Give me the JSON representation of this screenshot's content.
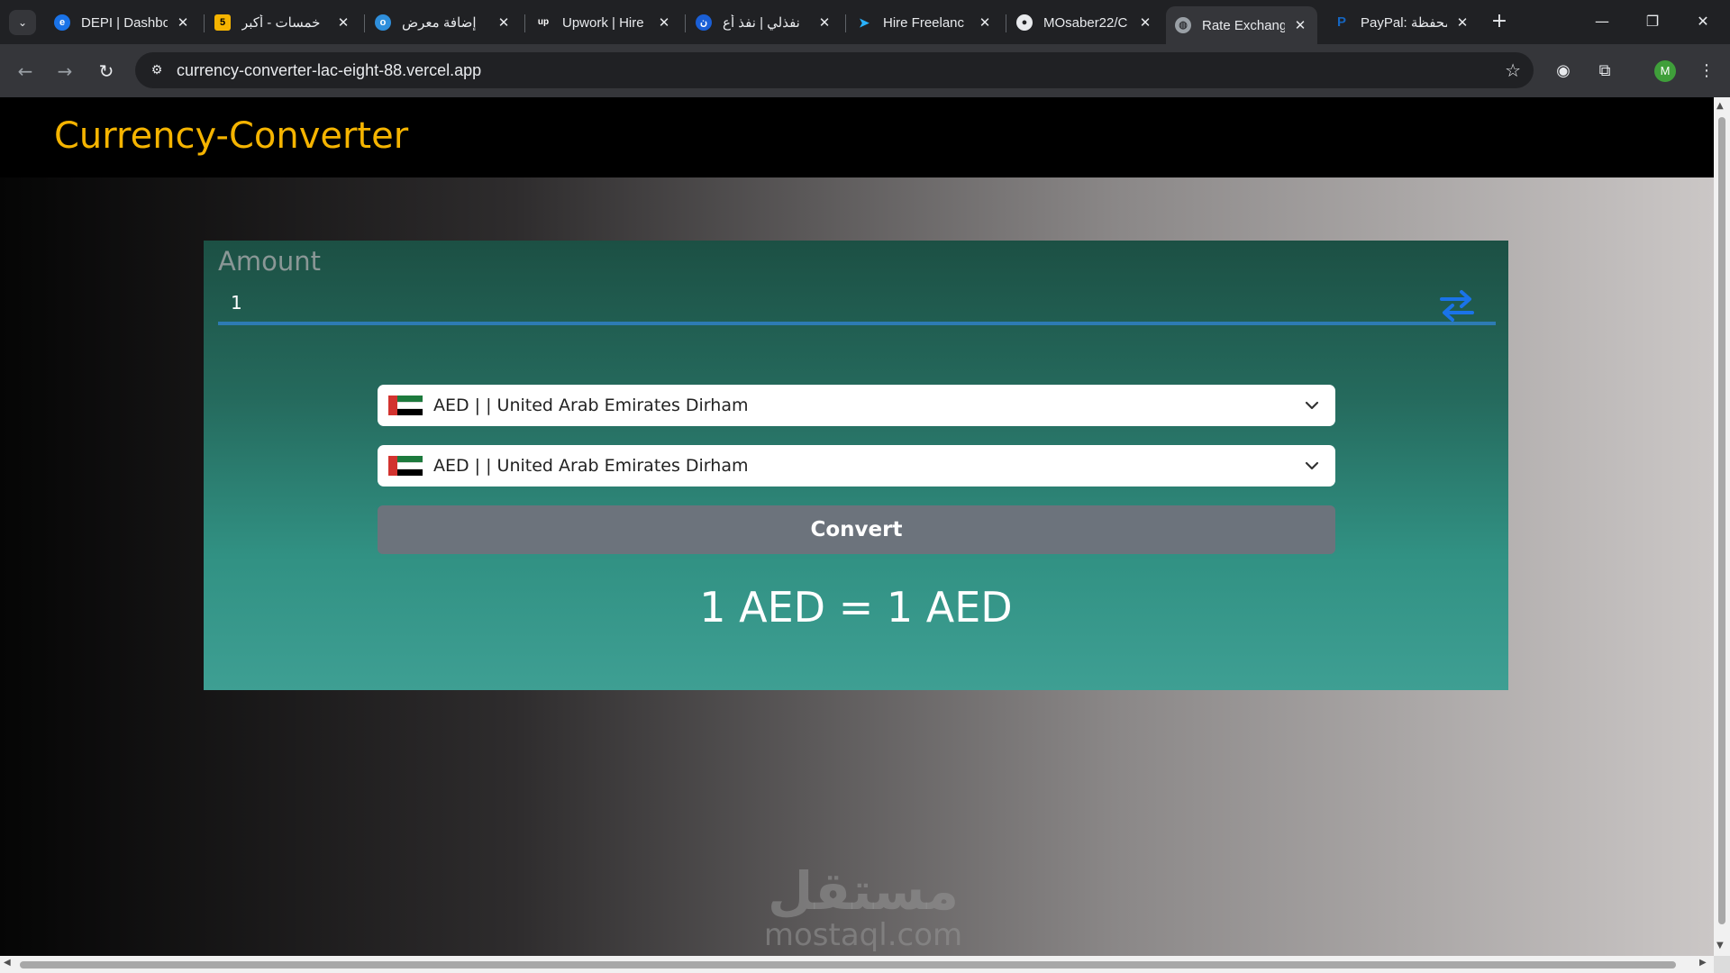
{
  "browser": {
    "tabs": [
      {
        "title": "DEPI | Dashbo",
        "favicon": "depi-icon",
        "color": "#1a73e8",
        "glyph": "e"
      },
      {
        "title": "خمسات - أكبر",
        "favicon": "khamsat-icon",
        "color": "#f5b400",
        "glyph": "5"
      },
      {
        "title": "إضافة معرض",
        "favicon": "mostaql-icon",
        "color": "#2f8fdc",
        "glyph": "o"
      },
      {
        "title": "Upwork | Hire",
        "favicon": "upwork-icon",
        "color": "#202124",
        "glyph": "up"
      },
      {
        "title": "نفذلي | نفذ أع",
        "favicon": "nafezly-icon",
        "color": "#1a5fd6",
        "glyph": "ن"
      },
      {
        "title": "Hire Freelanc",
        "favicon": "freelancer-icon",
        "color": "#29b2fe",
        "glyph": "➤"
      },
      {
        "title": "MOsaber22/C",
        "favicon": "github-icon",
        "color": "#e8eaed",
        "glyph": "●"
      },
      {
        "title": "Rate Exchang",
        "favicon": "globe-icon",
        "color": "#9aa0a6",
        "glyph": "◍"
      },
      {
        "title": "PayPal: محفظة",
        "favicon": "paypal-icon",
        "color": "#1565c0",
        "glyph": "P"
      }
    ],
    "new_tab": "+",
    "url": "currency-converter-lac-eight-88.vercel.app",
    "profile_initial": "M",
    "colors": {
      "tabstrip": "#202124",
      "toolbar": "#35363a",
      "profile": "#3f9f3a"
    }
  },
  "app": {
    "brand": "Currency-Converter",
    "brand_color": "#f5b400",
    "amount_label": "Amount",
    "amount_value": "1",
    "from_currency": {
      "code_label": "AED | | United Arab Emirates Dirham",
      "flag": "uae-flag"
    },
    "to_currency": {
      "code_label": "AED | | United Arab Emirates Dirham",
      "flag": "uae-flag"
    },
    "convert_label": "Convert",
    "result_text": "1 AED = 1 AED",
    "swap_icon": "swap-arrows-icon",
    "accent_color": "#1a73e8"
  },
  "watermark": {
    "arabic": "مستقل",
    "latin": "mostaql.com"
  }
}
